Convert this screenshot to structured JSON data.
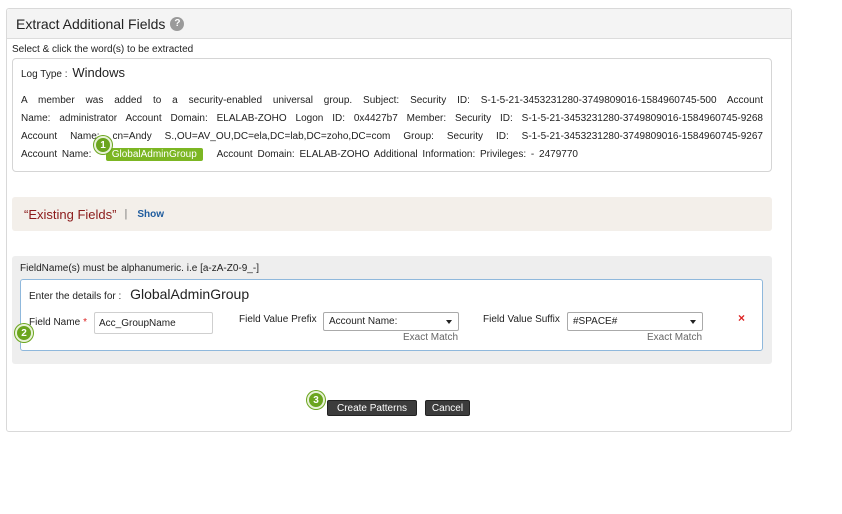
{
  "panel": {
    "title": "Extract Additional Fields",
    "help_icon": "?"
  },
  "instruction": "Select & click the word(s) to be extracted",
  "log": {
    "type_label": "Log Type :",
    "type_value": "Windows",
    "line1": "A member was added to a security-enabled universal group. Subject: Security ID: S-1-5-21-3453231280-3749809016-1584960745-500 Account",
    "line2": "Name: administrator Account Domain: ELALAB-ZOHO Logon ID: 0x4427b7 Member: Security ID: S-1-5-21-3453231280-3749809016-1584960745-9268",
    "line3": "Account Name: cn=Andy S.,OU=AV_OU,DC=ela,DC=lab,DC=zoho,DC=com Group: Security ID: S-1-5-21-3453231280-3749809016-1584960745-9267",
    "line4_prefix": "Account Name:",
    "line4_highlight": "GlobalAdminGroup",
    "line4_suffix": "Account Domain: ELALAB-ZOHO Additional Information: Privileges: - 2479770"
  },
  "existing": {
    "title": "“Existing Fields”",
    "separator": "|",
    "show_link": "Show"
  },
  "fields": {
    "note": "FieldName(s) must be alphanumeric. i.e [a-zA-Z0-9_-]",
    "details_label": "Enter the details for :",
    "details_value": "GlobalAdminGroup",
    "field_name_label": "Field Name",
    "required_mark": "*",
    "field_name_value": "Acc_GroupName",
    "prefix_label": "Field Value Prefix",
    "prefix_value": "Account Name:",
    "prefix_match": "Exact Match",
    "suffix_label": "Field Value Suffix",
    "suffix_value": "#SPACE#",
    "suffix_match": "Exact Match",
    "remove_icon": "×"
  },
  "buttons": {
    "create": "Create Patterns",
    "cancel": "Cancel"
  },
  "steps": [
    "1",
    "2",
    "3"
  ],
  "colors": {
    "highlight": "#7cb623",
    "step_badge": "#6ba51e",
    "existing_title": "#8b1a1a",
    "link": "#1f5c9e",
    "required": "#dd2222",
    "button": "#3c3c3c"
  }
}
